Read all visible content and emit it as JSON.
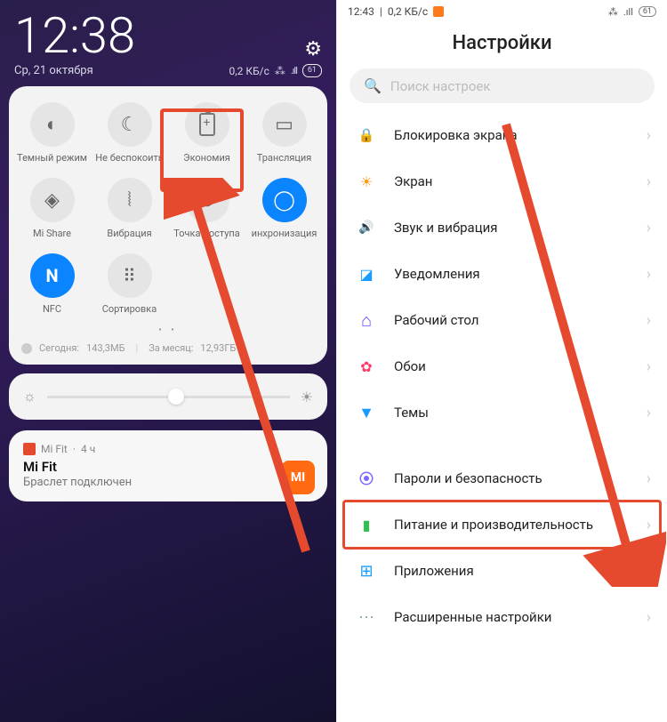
{
  "left": {
    "clock": "12:38",
    "date": "Ср, 21 октября",
    "net": "0,2 КБ/с",
    "batt": "61",
    "tiles": [
      {
        "label": "Темный режим"
      },
      {
        "label": "Не беспокоить"
      },
      {
        "label": "Экономия"
      },
      {
        "label": "Трансляция"
      },
      {
        "label": "Mi Share"
      },
      {
        "label": "Вибрация"
      },
      {
        "label": "Точка доступа"
      },
      {
        "label": "инхронизация"
      },
      {
        "label": "NFC"
      },
      {
        "label": "Сортировка"
      }
    ],
    "data_today_label": "Сегодня:",
    "data_today_value": "143,3МБ",
    "data_month_label": "За месяц:",
    "data_month_value": "12,93ГБ",
    "notif": {
      "app": "Mi Fit",
      "time": "4 ч",
      "title": "Mi Fit",
      "subtitle": "Браслет подключен",
      "badge": "MI"
    }
  },
  "right": {
    "clock": "12:43",
    "net": "0,2 КБ/с",
    "batt": "61",
    "title": "Настройки",
    "search_placeholder": "Поиск настроек",
    "items": [
      {
        "label": "Блокировка экрана"
      },
      {
        "label": "Экран"
      },
      {
        "label": "Звук и вибрация"
      },
      {
        "label": "Уведомления"
      },
      {
        "label": "Рабочий стол"
      },
      {
        "label": "Обои"
      },
      {
        "label": "Темы"
      }
    ],
    "items2": [
      {
        "label": "Пароли и безопасность"
      },
      {
        "label": "Питание и производительность"
      },
      {
        "label": "Приложения"
      },
      {
        "label": "Расширенные настройки"
      }
    ]
  }
}
